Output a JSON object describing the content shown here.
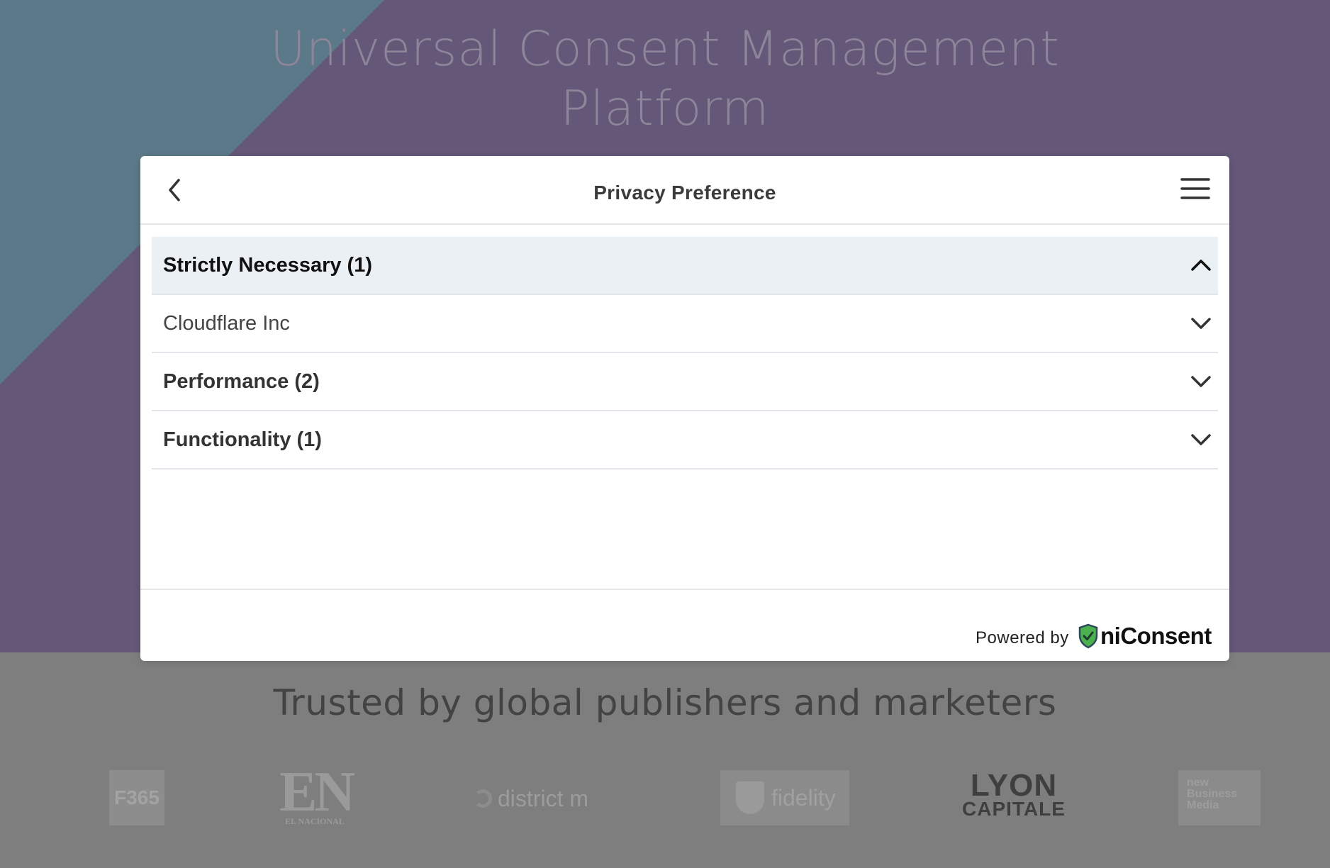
{
  "hero": {
    "title_line1": "Universal Consent Management",
    "title_line2": "Platform"
  },
  "trusted": {
    "title": "Trusted by global publishers and marketers",
    "logos": [
      {
        "name": "F365",
        "text": "F365"
      },
      {
        "name": "EN El Nacional",
        "text_big": "EN",
        "text_small": "EL NACIONAL"
      },
      {
        "name": "district m",
        "text": "district m"
      },
      {
        "name": "fidelity",
        "text": "fidelity"
      },
      {
        "name": "Lyon Capitale",
        "line1": "LYON",
        "line2": "CAPITALE"
      },
      {
        "name": "new Business Media",
        "text": "new Business Media"
      }
    ]
  },
  "modal": {
    "title": "Privacy Preference",
    "back_icon": "chevron-left-icon",
    "menu_icon": "hamburger-menu-icon",
    "items": [
      {
        "label": "Strictly Necessary (1)",
        "expanded": true,
        "style": "category"
      },
      {
        "label": "Cloudflare Inc",
        "expanded": false,
        "style": "vendor"
      },
      {
        "label": "Performance (2)",
        "expanded": false,
        "style": "category"
      },
      {
        "label": "Functionality (1)",
        "expanded": false,
        "style": "category"
      }
    ],
    "footer": {
      "powered_by": "Powered by",
      "brand_name": "niConsent",
      "brand_icon": "shield-check-icon",
      "brand_color": "#4caf50"
    }
  },
  "colors": {
    "hero_bg": "#645778",
    "hero_accent": "#5b7988",
    "overlay_gray": "#7e7e7e",
    "row_active_bg": "#ebf0f4"
  }
}
